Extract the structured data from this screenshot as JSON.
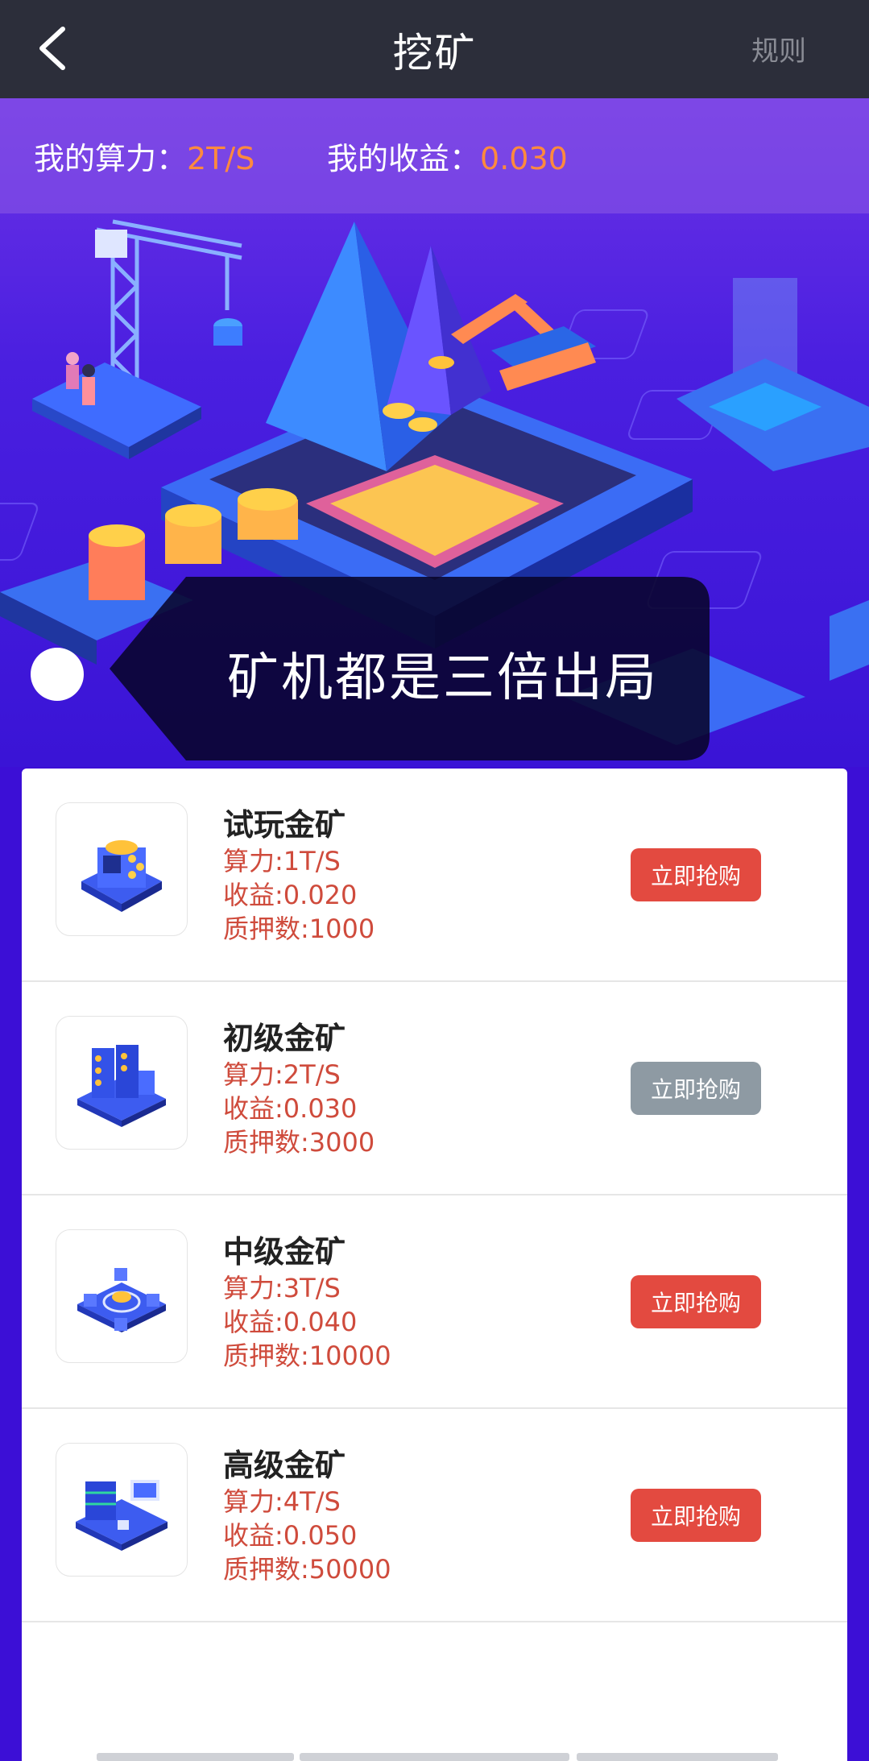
{
  "navbar": {
    "title": "挖矿",
    "rule_label": "规则",
    "back_icon": "chevron-left-icon"
  },
  "stats": {
    "power_label": "我的算力：",
    "power_value": "2T/S",
    "income_label": "我的收益：",
    "income_value": "0.030"
  },
  "notice": {
    "text": "矿机都是三倍出局"
  },
  "miners": [
    {
      "name": "试玩金矿",
      "power": "算力:1T/S",
      "income": "收益:0.020",
      "pledge": "质押数:1000",
      "button": "立即抢购",
      "enabled": true
    },
    {
      "name": "初级金矿",
      "power": "算力:2T/S",
      "income": "收益:0.030",
      "pledge": "质押数:3000",
      "button": "立即抢购",
      "enabled": false
    },
    {
      "name": "中级金矿",
      "power": "算力:3T/S",
      "income": "收益:0.040",
      "pledge": "质押数:10000",
      "button": "立即抢购",
      "enabled": true
    },
    {
      "name": "高级金矿",
      "power": "算力:4T/S",
      "income": "收益:0.050",
      "pledge": "质押数:50000",
      "button": "立即抢购",
      "enabled": true
    }
  ],
  "colors": {
    "accent_orange": "#ff8a3d",
    "button_red": "#e34a40",
    "button_disabled": "#8e9aa3",
    "detail_red": "#cf4b3c"
  }
}
